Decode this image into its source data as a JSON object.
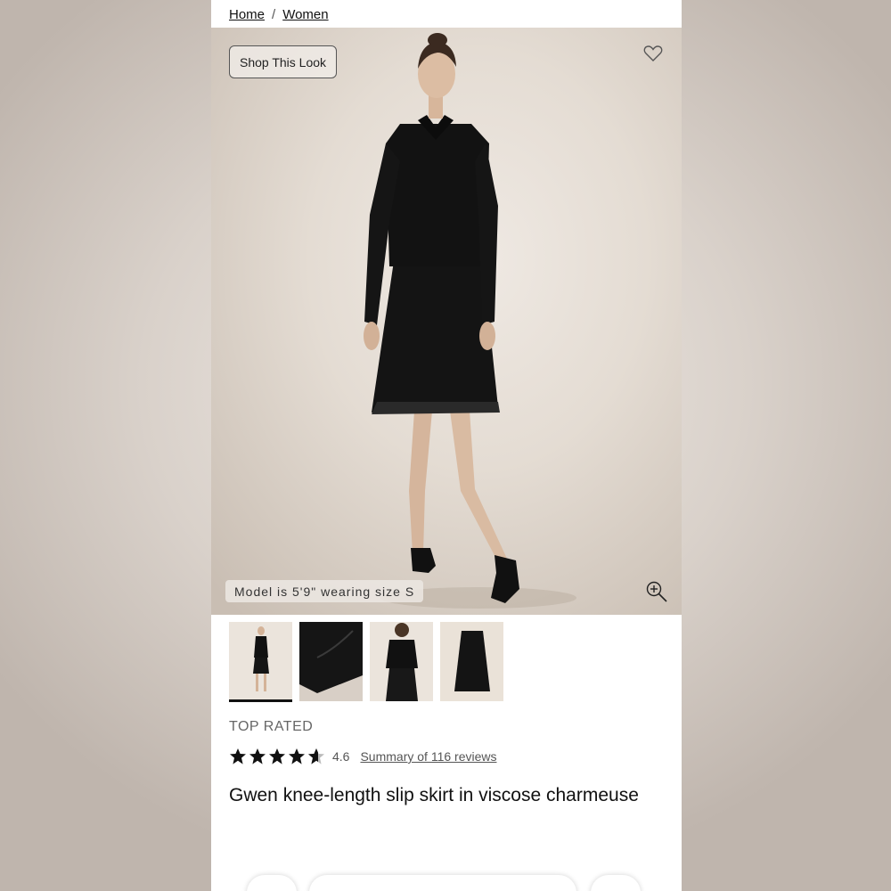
{
  "breadcrumb": {
    "items": [
      {
        "label": "Home"
      },
      {
        "label": "Women"
      }
    ],
    "separator": "/"
  },
  "hero": {
    "shop_look_label": "Shop This Look",
    "model_note": "Model is 5'9\" wearing size S",
    "favorite_icon": "heart-outline-icon",
    "zoom_icon": "zoom-in-icon"
  },
  "thumbnails": [
    {
      "name": "full-look",
      "active": true
    },
    {
      "name": "skirt-hem-detail",
      "active": false
    },
    {
      "name": "back-view",
      "active": false
    },
    {
      "name": "skirt-flat",
      "active": false
    }
  ],
  "product": {
    "badge": "TOP RATED",
    "rating": 4.6,
    "rating_label": "4.6",
    "reviews_link": "Summary of 116 reviews",
    "title": "Gwen knee-length slip skirt in viscose charmeuse"
  },
  "colors": {
    "accent": "#111111",
    "muted_text": "#666666",
    "backdrop": "#e6ddd3"
  }
}
